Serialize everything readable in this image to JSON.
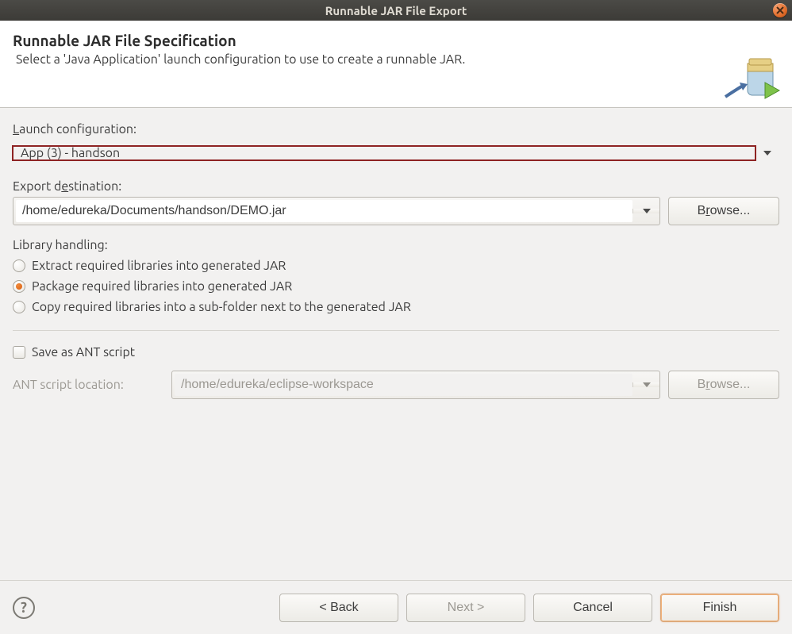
{
  "window": {
    "title": "Runnable JAR File Export"
  },
  "banner": {
    "heading": "Runnable JAR File Specification",
    "subtitle": "Select a 'Java Application' launch configuration to use to create a runnable JAR."
  },
  "launch": {
    "label_pre": "L",
    "label_post": "aunch configuration:",
    "value": "App (3) - handson"
  },
  "destination": {
    "label_pre": "Export d",
    "label_mn": "e",
    "label_post": "stination:",
    "value": "/home/edureka/Documents/handson/DEMO.jar",
    "browse_pre": "B",
    "browse_mn": "r",
    "browse_post": "owse..."
  },
  "library": {
    "label": "Library handling:",
    "options": [
      {
        "mn": "E",
        "rest": "xtract required libraries into generated JAR",
        "checked": false
      },
      {
        "mn": "P",
        "rest": "ackage required libraries into generated JAR",
        "checked": true
      },
      {
        "mn": "C",
        "rest": "opy required libraries into a sub-folder next to the generated JAR",
        "checked": false
      }
    ]
  },
  "ant": {
    "save_mn": "S",
    "save_rest": "ave as ANT script",
    "checked": false,
    "loc_mn": "A",
    "loc_rest": "NT script location:",
    "value": "/home/edureka/eclipse-workspace",
    "browse_pre": "B",
    "browse_mn": "r",
    "browse_post": "owse..."
  },
  "buttons": {
    "back": "< Back",
    "next": "Next >",
    "cancel": "Cancel",
    "finish": "Finish"
  }
}
